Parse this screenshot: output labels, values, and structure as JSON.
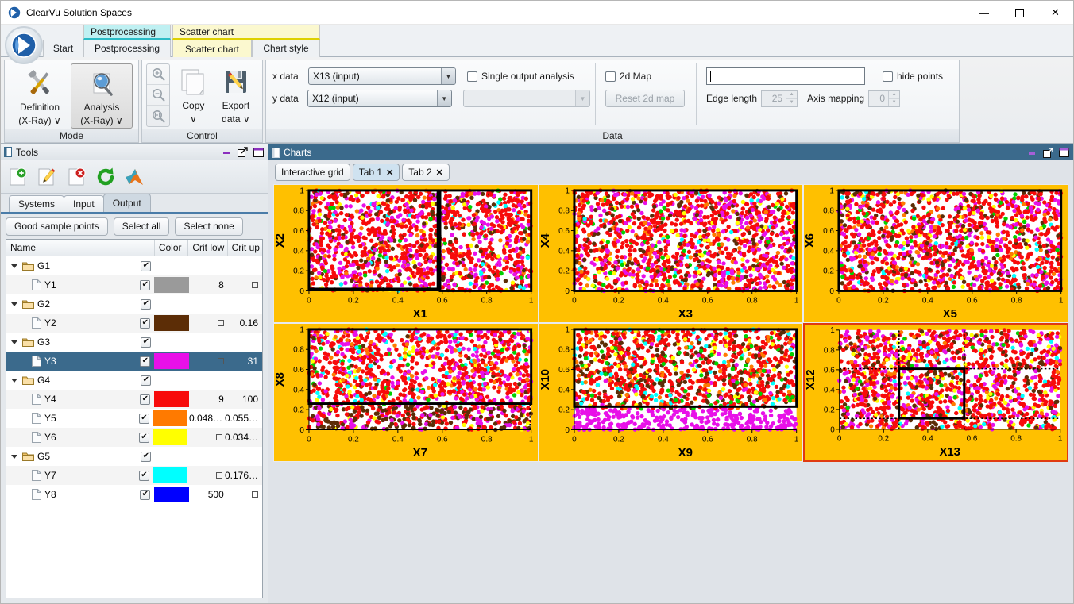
{
  "window": {
    "title": "ClearVu Solution Spaces",
    "controls": {
      "minimize": "—",
      "maximize": "☐",
      "close": "✕"
    }
  },
  "ribbon": {
    "contextual_groups": [
      {
        "label": "Postprocessing",
        "accent": "#2bbcc6"
      },
      {
        "label": "Scatter chart",
        "accent": "#ded000"
      }
    ],
    "tabs": [
      {
        "label": "Start",
        "active": false
      },
      {
        "label": "Postprocessing",
        "active": false
      },
      {
        "label": "Scatter chart",
        "active": true
      },
      {
        "label": "Chart style",
        "active": false
      }
    ],
    "groups": [
      {
        "name": "Mode",
        "buttons": [
          {
            "label": "Definition",
            "sublabel": "(X-Ray) ∨",
            "icon": "tools-icon",
            "selected": false
          },
          {
            "label": "Analysis",
            "sublabel": "(X-Ray) ∨",
            "icon": "magnifier-icon",
            "selected": true
          }
        ]
      },
      {
        "name": "Control",
        "zoom_buttons": [
          {
            "icon": "zoom-in-icon"
          },
          {
            "icon": "zoom-out-icon"
          },
          {
            "icon": "zoom-reset-icon"
          }
        ],
        "buttons": [
          {
            "label": "Copy",
            "sublabel": "∨",
            "icon": "copy-icon"
          },
          {
            "label": "Export",
            "sublabel": "data ∨",
            "icon": "export-data-icon"
          }
        ]
      }
    ],
    "data_group": {
      "name": "Data",
      "x_data_label": "x data",
      "x_data_value": "X13 (input)",
      "y_data_label": "y data",
      "y_data_value": "X12 (input)",
      "single_output_analysis_label": "Single output analysis",
      "single_output_analysis_checked": false,
      "output_select_value": "",
      "two_d_map_label": "2d Map",
      "two_d_map_checked": false,
      "reset_2d_map_label": "Reset 2d map",
      "filter_value": "",
      "hide_points_label": "hide points",
      "hide_points_checked": false,
      "edge_length_label": "Edge length",
      "edge_length_value": "25",
      "axis_mapping_label": "Axis mapping",
      "axis_mapping_value": "0"
    }
  },
  "tools_panel": {
    "title": "Tools",
    "toolbar": [
      {
        "icon": "new-document-icon",
        "name": "add"
      },
      {
        "icon": "edit-document-icon",
        "name": "edit"
      },
      {
        "icon": "delete-document-icon",
        "name": "delete"
      },
      {
        "icon": "refresh-icon",
        "name": "refresh"
      },
      {
        "icon": "matlab-icon",
        "name": "matlab"
      }
    ],
    "tabs": [
      {
        "label": "Systems",
        "active": false
      },
      {
        "label": "Input",
        "active": false
      },
      {
        "label": "Output",
        "active": true
      }
    ],
    "actions": [
      {
        "label": "Good sample points"
      },
      {
        "label": "Select all"
      },
      {
        "label": "Select none"
      }
    ],
    "table": {
      "columns": [
        "Name",
        "",
        "Color",
        "Crit low",
        "Crit up"
      ],
      "rows": [
        {
          "type": "group",
          "name": "G1",
          "checked": true,
          "color": null,
          "crit_low": "",
          "crit_up": "",
          "selected": false
        },
        {
          "type": "item",
          "name": "Y1",
          "checked": true,
          "color": "#9a9a9a",
          "crit_low": "8",
          "crit_up": "box",
          "selected": false
        },
        {
          "type": "group",
          "name": "G2",
          "checked": true,
          "color": null,
          "crit_low": "",
          "crit_up": "",
          "selected": false
        },
        {
          "type": "item",
          "name": "Y2",
          "checked": true,
          "color": "#5c2d06",
          "crit_low": "box",
          "crit_up": "0.16",
          "selected": false
        },
        {
          "type": "group",
          "name": "G3",
          "checked": true,
          "color": null,
          "crit_low": "",
          "crit_up": "",
          "selected": false
        },
        {
          "type": "item",
          "name": "Y3",
          "checked": true,
          "color": "#e810e8",
          "crit_low": "box",
          "crit_up": "31",
          "selected": true
        },
        {
          "type": "group",
          "name": "G4",
          "checked": true,
          "color": null,
          "crit_low": "",
          "crit_up": "",
          "selected": false
        },
        {
          "type": "item",
          "name": "Y4",
          "checked": true,
          "color": "#f70b0b",
          "crit_low": "9",
          "crit_up": "100",
          "selected": false
        },
        {
          "type": "item",
          "name": "Y5",
          "checked": true,
          "color": "#ff7a00",
          "crit_low": "0.048…",
          "crit_up": "0.055…",
          "selected": false
        },
        {
          "type": "item",
          "name": "Y6",
          "checked": true,
          "color": "#ffff00",
          "crit_low": "box",
          "crit_up": "0.034…",
          "selected": false
        },
        {
          "type": "group",
          "name": "G5",
          "checked": true,
          "color": null,
          "crit_low": "",
          "crit_up": "",
          "selected": false
        },
        {
          "type": "item",
          "name": "Y7",
          "checked": true,
          "color": "#00ffff",
          "crit_low": "box",
          "crit_up": "0.176…",
          "selected": false
        },
        {
          "type": "item",
          "name": "Y8",
          "checked": true,
          "color": "#0000ff",
          "crit_low": "500",
          "crit_up": "box",
          "selected": false
        }
      ]
    }
  },
  "charts_panel": {
    "title": "Charts",
    "tabs": [
      {
        "label": "Interactive grid",
        "closable": false,
        "active": false
      },
      {
        "label": "Tab 1",
        "closable": true,
        "active": true
      },
      {
        "label": "Tab 2",
        "closable": true,
        "active": false
      }
    ]
  },
  "chart_data": [
    {
      "type": "scatter",
      "id": "chart-x1-x2",
      "xlabel": "X1",
      "ylabel": "X2",
      "xlim": [
        0,
        1
      ],
      "ylim": [
        0,
        1
      ],
      "xticks": [
        "0",
        "0.2",
        "0.4",
        "0.6",
        "0.8",
        "1"
      ],
      "yticks": [
        "0",
        "0.2",
        "0.4",
        "0.6",
        "0.8",
        "1"
      ],
      "n_points": 1400,
      "selected": false,
      "background": "#ffc000",
      "boxes": [
        {
          "style": "solid",
          "x0": 0.0,
          "x1": 0.58,
          "y0": 0.02,
          "y1": 1.0
        },
        {
          "style": "solid",
          "x0": 0.59,
          "x1": 1.0,
          "y0": 0.0,
          "y1": 1.0
        }
      ],
      "dotted": [
        {
          "orient": "h",
          "value": 0.015,
          "x0": 0.0,
          "x1": 0.58
        }
      ],
      "palette": [
        "#f70b0b",
        "#e810e8",
        "#5c2d06",
        "#ff7a00",
        "#ffff00",
        "#00ffff",
        "#00d000"
      ],
      "weights": [
        0.5,
        0.24,
        0.12,
        0.06,
        0.04,
        0.02,
        0.02
      ]
    },
    {
      "type": "scatter",
      "id": "chart-x3-x4",
      "xlabel": "X3",
      "ylabel": "X4",
      "xlim": [
        0,
        1
      ],
      "ylim": [
        0,
        1
      ],
      "xticks": [
        "0",
        "0.2",
        "0.4",
        "0.6",
        "0.8",
        "1"
      ],
      "yticks": [
        "0",
        "0.2",
        "0.4",
        "0.6",
        "0.8",
        "1"
      ],
      "n_points": 1400,
      "selected": false,
      "background": "#ffc000",
      "boxes": [
        {
          "style": "solid",
          "x0": 0.0,
          "x1": 1.0,
          "y0": 0.0,
          "y1": 1.0
        }
      ],
      "dotted": [],
      "palette": [
        "#f70b0b",
        "#e810e8",
        "#5c2d06",
        "#ff7a00",
        "#ffff00",
        "#00ffff",
        "#00d000"
      ],
      "weights": [
        0.48,
        0.23,
        0.12,
        0.07,
        0.05,
        0.02,
        0.03
      ]
    },
    {
      "type": "scatter",
      "id": "chart-x5-x6",
      "xlabel": "X5",
      "ylabel": "X6",
      "xlim": [
        0,
        1
      ],
      "ylim": [
        0,
        1
      ],
      "xticks": [
        "0",
        "0.2",
        "0.4",
        "0.6",
        "0.8",
        "1"
      ],
      "yticks": [
        "0",
        "0.2",
        "0.4",
        "0.6",
        "0.8",
        "1"
      ],
      "n_points": 1400,
      "selected": false,
      "background": "#ffc000",
      "boxes": [
        {
          "style": "solid",
          "x0": 0.0,
          "x1": 1.0,
          "y0": 0.0,
          "y1": 1.0
        }
      ],
      "dotted": [],
      "palette": [
        "#f70b0b",
        "#e810e8",
        "#5c2d06",
        "#ff7a00",
        "#ffff00",
        "#00ffff",
        "#00d000"
      ],
      "weights": [
        0.5,
        0.22,
        0.12,
        0.06,
        0.05,
        0.02,
        0.03
      ]
    },
    {
      "type": "scatter",
      "id": "chart-x7-x8",
      "xlabel": "X7",
      "ylabel": "X8",
      "xlim": [
        0,
        1
      ],
      "ylim": [
        0,
        1
      ],
      "xticks": [
        "0",
        "0.2",
        "0.4",
        "0.6",
        "0.8",
        "1"
      ],
      "yticks": [
        "0",
        "0.2",
        "0.4",
        "0.6",
        "0.8",
        "1"
      ],
      "n_points": 1400,
      "selected": false,
      "background": "#ffc000",
      "boxes": [
        {
          "style": "solid",
          "x0": 0.0,
          "x1": 1.0,
          "y0": 0.26,
          "y1": 1.0
        }
      ],
      "dotted": [
        {
          "orient": "v",
          "value": 0.995,
          "y0": 0.0,
          "y1": 0.25
        }
      ],
      "split": {
        "orient": "h",
        "value": 0.25,
        "below_palette": [
          "#5c2d06",
          "#f70b0b",
          "#e810e8",
          "#ffff00"
        ],
        "below_weights": [
          0.45,
          0.3,
          0.2,
          0.05
        ]
      },
      "palette": [
        "#f70b0b",
        "#e810e8",
        "#ff7a00",
        "#00ffff",
        "#ffff00",
        "#00d000",
        "#5c2d06"
      ],
      "weights": [
        0.56,
        0.2,
        0.07,
        0.06,
        0.05,
        0.03,
        0.03
      ]
    },
    {
      "type": "scatter",
      "id": "chart-x9-x10",
      "xlabel": "X9",
      "ylabel": "X10",
      "xlim": [
        0,
        1
      ],
      "ylim": [
        0,
        1
      ],
      "xticks": [
        "0",
        "0.2",
        "0.4",
        "0.6",
        "0.8",
        "1"
      ],
      "yticks": [
        "0",
        "0.2",
        "0.4",
        "0.6",
        "0.8",
        "1"
      ],
      "n_points": 1400,
      "selected": false,
      "background": "#ffc000",
      "boxes": [
        {
          "style": "solid",
          "x0": 0.0,
          "x1": 1.0,
          "y0": 0.23,
          "y1": 1.0
        }
      ],
      "dotted": [],
      "split": {
        "orient": "h",
        "value": 0.21,
        "below_palette": [
          "#e810e8"
        ],
        "below_weights": [
          1.0
        ]
      },
      "palette": [
        "#f70b0b",
        "#5c2d06",
        "#ffff00",
        "#ff7a00",
        "#00d000",
        "#00ffff",
        "#e810e8"
      ],
      "weights": [
        0.52,
        0.18,
        0.08,
        0.07,
        0.06,
        0.05,
        0.04
      ]
    },
    {
      "type": "scatter",
      "id": "chart-x13-x12",
      "xlabel": "X13",
      "ylabel": "X12",
      "xlim": [
        0,
        1
      ],
      "ylim": [
        0,
        1
      ],
      "xticks": [
        "0",
        "0.2",
        "0.4",
        "0.6",
        "0.8",
        "1"
      ],
      "yticks": [
        "0",
        "0.2",
        "0.4",
        "0.6",
        "0.8",
        "1"
      ],
      "n_points": 1400,
      "selected": true,
      "background": "#ffc000",
      "boxes": [
        {
          "style": "solid",
          "x0": 0.27,
          "x1": 0.565,
          "y0": 0.11,
          "y1": 0.61
        }
      ],
      "dotted": [
        {
          "orient": "h",
          "value": 0.61,
          "x0": 0.0,
          "x1": 1.0
        },
        {
          "orient": "h",
          "value": 0.11,
          "x0": 0.0,
          "x1": 1.0
        },
        {
          "orient": "v",
          "value": 0.27,
          "y0": 0.0,
          "y1": 1.0
        },
        {
          "orient": "v",
          "value": 0.565,
          "y0": 0.0,
          "y1": 1.0
        }
      ],
      "palette": [
        "#f70b0b",
        "#e810e8",
        "#5c2d06",
        "#ffff00",
        "#ff7a00",
        "#00ffff",
        "#00d000"
      ],
      "weights": [
        0.5,
        0.2,
        0.12,
        0.08,
        0.05,
        0.03,
        0.02
      ]
    }
  ]
}
